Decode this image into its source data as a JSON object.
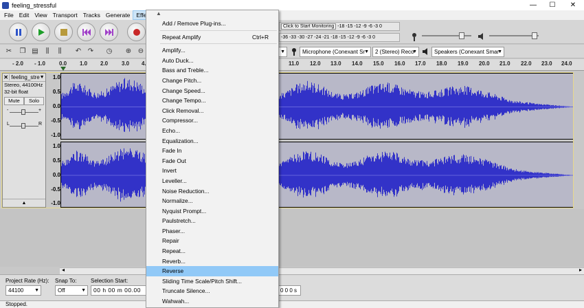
{
  "window": {
    "title": "feeling_stressful",
    "controls": [
      "—",
      "☐",
      "✕"
    ]
  },
  "menubar": {
    "items": [
      "File",
      "Edit",
      "View",
      "Transport",
      "Tracks",
      "Generate",
      "Effect"
    ],
    "active": "Effect"
  },
  "meters": {
    "record_label": "Click to Start Monitoring",
    "record_scale": "-18 -15 -12 -9 -6 -3 0",
    "play_scale": "-36 -33 -30 -27 -24 -21 -18 -15 -12 -9 -6 -3 0"
  },
  "devices": {
    "host_partial": "",
    "mic_icon": "microphone-icon",
    "input_device": "Microphone (Conexant Sr",
    "channels": "2 (Stereo) Reco",
    "output_device": "Speakers (Conexant Smar"
  },
  "ruler": {
    "ticks_left": [
      "- 2.0",
      "- 1.0",
      "0.0",
      "1.0",
      "2.0",
      "3.0",
      "4."
    ],
    "ticks_right": [
      "11.0",
      "12.0",
      "13.0",
      "14.0",
      "15.0",
      "16.0",
      "17.0",
      "18.0",
      "19.0",
      "20.0",
      "21.0",
      "22.0",
      "23.0",
      "24.0"
    ]
  },
  "track": {
    "name": "feeling_stre",
    "rate": "Stereo, 44100Hz",
    "format": "32-bit float",
    "mute": "Mute",
    "solo": "Solo",
    "gain_minus": "-",
    "gain_plus": "+",
    "pan_l": "L",
    "pan_r": "R",
    "scale_ch1": [
      "1.0",
      "0.5",
      "0.0",
      "-0.5",
      "-1.0"
    ],
    "scale_ch2": [
      "1.0",
      "0.5",
      "0.0",
      "-0.5",
      "-1.0"
    ]
  },
  "selection_bar": {
    "project_rate_label": "Project Rate (Hz):",
    "project_rate_value": "44100",
    "snap_label": "Snap To:",
    "snap_value": "Off",
    "selection_start_label": "Selection Start:",
    "selection_start_value": "00 h 00 m 00.00",
    "selection_end_value": "0 0 0 s"
  },
  "status": {
    "text": "Stopped."
  },
  "effect_menu": {
    "top_items": [
      {
        "label": "Add / Remove Plug-ins...",
        "shortcut": ""
      },
      {
        "label": "Repeat Amplify",
        "shortcut": "Ctrl+R"
      }
    ],
    "items": [
      "Amplify...",
      "Auto Duck...",
      "Bass and Treble...",
      "Change Pitch...",
      "Change Speed...",
      "Change Tempo...",
      "Click Removal...",
      "Compressor...",
      "Echo...",
      "Equalization...",
      "Fade In",
      "Fade Out",
      "Invert",
      "Leveller...",
      "Noise Reduction...",
      "Normalize...",
      "Nyquist Prompt...",
      "Paulstretch...",
      "Phaser...",
      "Repair",
      "Repeat...",
      "Reverb...",
      "Reverse",
      "Sliding Time Scale/Pitch Shift...",
      "Truncate Silence...",
      "Wahwah..."
    ],
    "highlighted": "Reverse"
  },
  "colors": {
    "waveform": "#3232c8",
    "waveform_rms": "#6464dc",
    "selection_bg": "#b8b8c8",
    "highlight": "#91c9f7"
  }
}
